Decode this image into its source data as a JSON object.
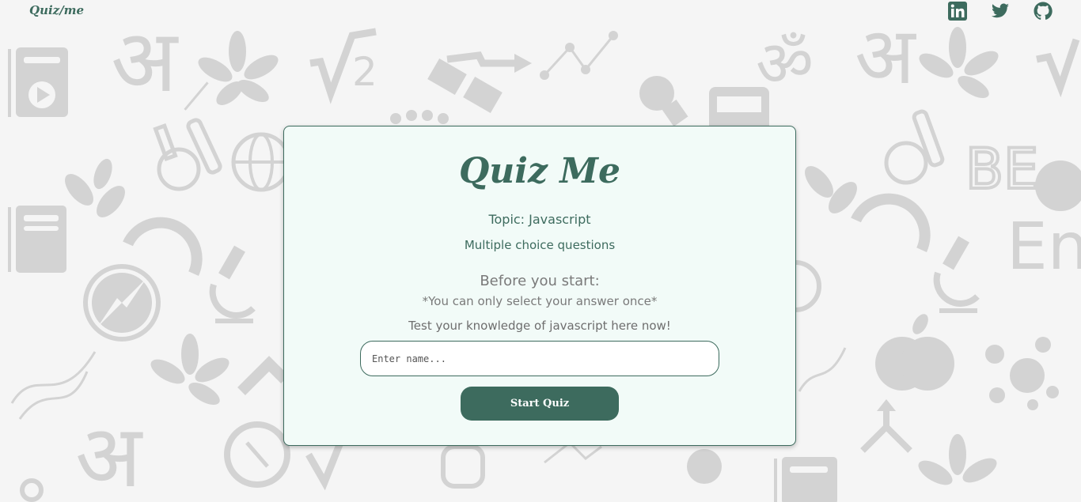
{
  "header": {
    "brand": "Quiz/me",
    "social_icons": [
      "linkedin-icon",
      "twitter-icon",
      "github-icon"
    ]
  },
  "card": {
    "title": "Quiz Me",
    "topic": "Topic: Javascript",
    "question_type": "Multiple choice questions",
    "before_heading": "Before you start:",
    "rule": "*You can only select your answer once*",
    "tagline": "Test your knowledge of javascript here now!",
    "name_placeholder": "Enter name...",
    "name_value": "",
    "start_label": "Start Quiz"
  },
  "colors": {
    "accent": "#3d6b5e",
    "card_bg": "#f2fbf8",
    "page_bg": "#f5f5f5",
    "doodle": "#d3d3d3"
  },
  "background_icons": [
    "video-book-icon",
    "devanagari-a-icon",
    "leaf-icon",
    "sqrt-2-icon",
    "chart-icon",
    "lightbulb-icon",
    "calculator-icon",
    "om-icon",
    "flask-icon",
    "globe-icon",
    "protractor-icon",
    "microscope-icon",
    "compass-icon",
    "dna-icon",
    "clock-icon",
    "apple-icon",
    "molecules-icon",
    "book-icon",
    "english-icon"
  ]
}
